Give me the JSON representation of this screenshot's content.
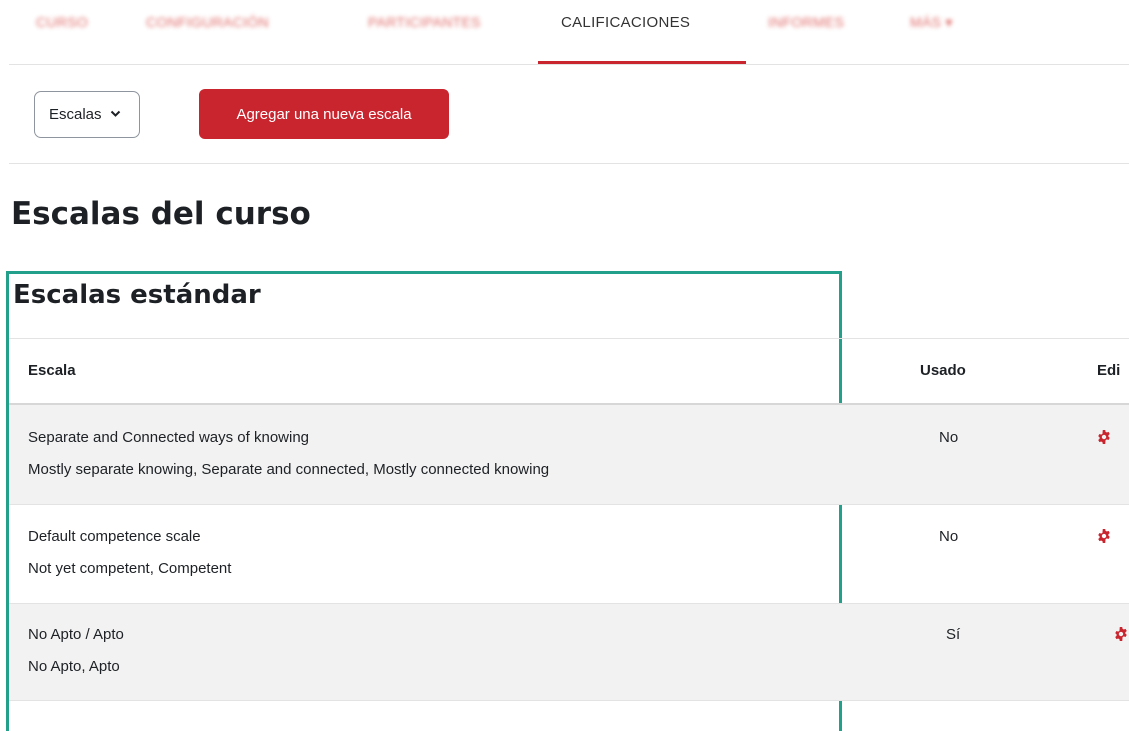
{
  "nav": {
    "tabs": [
      {
        "label": "CURSO",
        "state": "blurred"
      },
      {
        "label": "CONFIGURACIÓN",
        "state": "blurred"
      },
      {
        "label": "PARTICIPANTES",
        "state": "blurred"
      },
      {
        "label": "CALIFICACIONES",
        "state": "active"
      },
      {
        "label": "INFORMES",
        "state": "blurred"
      },
      {
        "label": "MÁS ▾",
        "state": "blurred"
      }
    ]
  },
  "toolbar": {
    "select_value": "Escalas",
    "add_button_label": "Agregar una nueva escala"
  },
  "page_title": "Escalas del curso",
  "section_title": "Escalas estándar",
  "table": {
    "headers": {
      "scale": "Escala",
      "used": "Usado",
      "edit": "Edi"
    },
    "rows": [
      {
        "name": "Separate and Connected ways of knowing",
        "items": "Mostly separate knowing, Separate and connected, Mostly connected knowing",
        "used": "No"
      },
      {
        "name": "Default competence scale",
        "items": "Not yet competent, Competent",
        "used": "No"
      },
      {
        "name": "No Apto / Apto",
        "items": "No Apto, Apto",
        "used": "Sí"
      }
    ]
  },
  "colors": {
    "brand": "#c9252f",
    "highlight": "#23a08c",
    "row_shade": "#f2f2f2"
  },
  "icons": {
    "edit": "gear-icon",
    "select": "chevron-down-icon"
  }
}
